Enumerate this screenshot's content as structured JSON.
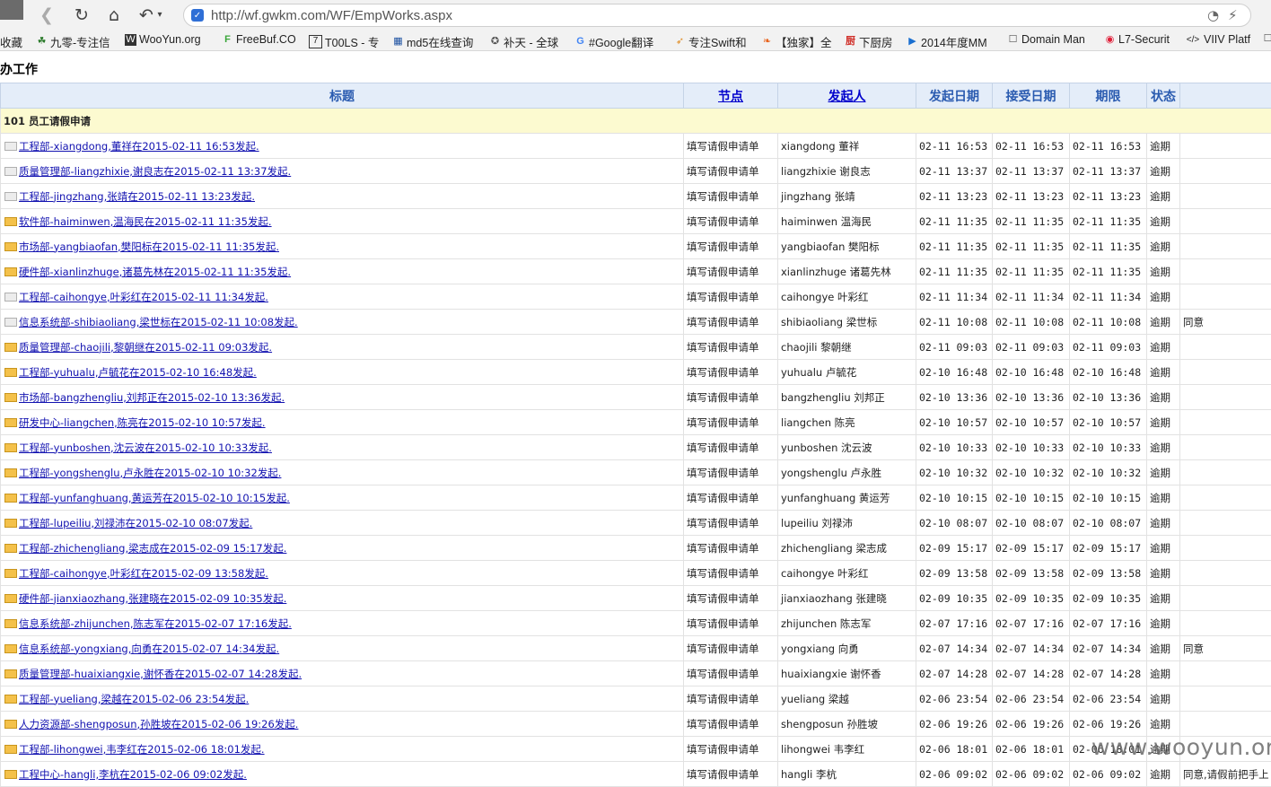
{
  "browser": {
    "url": "http://wf.gwkm.com/WF/EmpWorks.aspx",
    "bookmarks": [
      {
        "label": "收藏",
        "icon": "none-icon"
      },
      {
        "label": "九零-专注信",
        "icon": "leaf-icon"
      },
      {
        "label": "WooYun.org",
        "icon": "wooyun-icon"
      },
      {
        "label": "FreeBuf.CO",
        "icon": "freebuf-icon"
      },
      {
        "label": "T00LS - 专",
        "icon": "tools-icon"
      },
      {
        "label": "md5在线查询",
        "icon": "grid-icon"
      },
      {
        "label": "补天 - 全球",
        "icon": "star-icon"
      },
      {
        "label": "#Google翻译",
        "icon": "translate-icon"
      },
      {
        "label": "专注Swift和",
        "icon": "swift-icon"
      },
      {
        "label": "【独家】全",
        "icon": "fire-icon"
      },
      {
        "label": "下厨房",
        "icon": "kitchen-icon"
      },
      {
        "label": "2014年度MM",
        "icon": "play-icon"
      },
      {
        "label": "Domain Man",
        "icon": "page-icon"
      },
      {
        "label": "L7-Securit",
        "icon": "l7-icon"
      },
      {
        "label": "VIIV Platf",
        "icon": "code-icon"
      }
    ]
  },
  "page": {
    "title": "办工作",
    "columns": {
      "title": "标题",
      "node": "节点",
      "initiator": "发起人",
      "start_date": "发起日期",
      "accept_date": "接受日期",
      "deadline": "期限",
      "status": "状态"
    },
    "group": "101  员工请假申请",
    "rows": [
      {
        "icon": "doc",
        "title": "工程部-xiangdong,董祥在2015-02-11 16:53发起.",
        "node": "填写请假申请单",
        "initiator": "xiangdong 董祥",
        "start": "02-11 16:53",
        "accept": "02-11 16:53",
        "deadline": "02-11 16:53",
        "status": "逾期",
        "note": ""
      },
      {
        "icon": "doc",
        "title": "质量管理部-liangzhixie,谢良志在2015-02-11 13:37发起.",
        "node": "填写请假申请单",
        "initiator": "liangzhixie 谢良志",
        "start": "02-11 13:37",
        "accept": "02-11 13:37",
        "deadline": "02-11 13:37",
        "status": "逾期",
        "note": ""
      },
      {
        "icon": "doc",
        "title": "工程部-jingzhang,张靖在2015-02-11 13:23发起.",
        "node": "填写请假申请单",
        "initiator": "jingzhang 张靖",
        "start": "02-11 13:23",
        "accept": "02-11 13:23",
        "deadline": "02-11 13:23",
        "status": "逾期",
        "note": ""
      },
      {
        "icon": "folder",
        "title": "软件部-haiminwen,温海民在2015-02-11 11:35发起.",
        "node": "填写请假申请单",
        "initiator": "haiminwen 温海民",
        "start": "02-11 11:35",
        "accept": "02-11 11:35",
        "deadline": "02-11 11:35",
        "status": "逾期",
        "note": ""
      },
      {
        "icon": "folder",
        "title": "市场部-yangbiaofan,樊阳标在2015-02-11 11:35发起.",
        "node": "填写请假申请单",
        "initiator": "yangbiaofan 樊阳标",
        "start": "02-11 11:35",
        "accept": "02-11 11:35",
        "deadline": "02-11 11:35",
        "status": "逾期",
        "note": ""
      },
      {
        "icon": "folder",
        "title": "硬件部-xianlinzhuge,诸葛先林在2015-02-11 11:35发起.",
        "node": "填写请假申请单",
        "initiator": "xianlinzhuge 诸葛先林",
        "start": "02-11 11:35",
        "accept": "02-11 11:35",
        "deadline": "02-11 11:35",
        "status": "逾期",
        "note": ""
      },
      {
        "icon": "doc",
        "title": "工程部-caihongye,叶彩红在2015-02-11 11:34发起.",
        "node": "填写请假申请单",
        "initiator": "caihongye 叶彩红",
        "start": "02-11 11:34",
        "accept": "02-11 11:34",
        "deadline": "02-11 11:34",
        "status": "逾期",
        "note": ""
      },
      {
        "icon": "doc",
        "title": "信息系统部-shibiaoliang,梁世标在2015-02-11 10:08发起.",
        "node": "填写请假申请单",
        "initiator": "shibiaoliang 梁世标",
        "start": "02-11 10:08",
        "accept": "02-11 10:08",
        "deadline": "02-11 10:08",
        "status": "逾期",
        "note": "同意"
      },
      {
        "icon": "folder",
        "title": "质量管理部-chaojili,黎朝继在2015-02-11 09:03发起.",
        "node": "填写请假申请单",
        "initiator": "chaojili 黎朝继",
        "start": "02-11 09:03",
        "accept": "02-11 09:03",
        "deadline": "02-11 09:03",
        "status": "逾期",
        "note": ""
      },
      {
        "icon": "folder",
        "title": "工程部-yuhualu,卢毓花在2015-02-10 16:48发起.",
        "node": "填写请假申请单",
        "initiator": "yuhualu 卢毓花",
        "start": "02-10 16:48",
        "accept": "02-10 16:48",
        "deadline": "02-10 16:48",
        "status": "逾期",
        "note": ""
      },
      {
        "icon": "folder",
        "title": "市场部-bangzhengliu,刘邦正在2015-02-10 13:36发起.",
        "node": "填写请假申请单",
        "initiator": "bangzhengliu 刘邦正",
        "start": "02-10 13:36",
        "accept": "02-10 13:36",
        "deadline": "02-10 13:36",
        "status": "逾期",
        "note": ""
      },
      {
        "icon": "folder",
        "title": "研发中心-liangchen,陈亮在2015-02-10 10:57发起.",
        "node": "填写请假申请单",
        "initiator": "liangchen 陈亮",
        "start": "02-10 10:57",
        "accept": "02-10 10:57",
        "deadline": "02-10 10:57",
        "status": "逾期",
        "note": ""
      },
      {
        "icon": "folder",
        "title": "工程部-yunboshen,沈云波在2015-02-10 10:33发起.",
        "node": "填写请假申请单",
        "initiator": "yunboshen 沈云波",
        "start": "02-10 10:33",
        "accept": "02-10 10:33",
        "deadline": "02-10 10:33",
        "status": "逾期",
        "note": ""
      },
      {
        "icon": "folder",
        "title": "工程部-yongshenglu,卢永胜在2015-02-10 10:32发起.",
        "node": "填写请假申请单",
        "initiator": "yongshenglu 卢永胜",
        "start": "02-10 10:32",
        "accept": "02-10 10:32",
        "deadline": "02-10 10:32",
        "status": "逾期",
        "note": ""
      },
      {
        "icon": "folder",
        "title": "工程部-yunfanghuang,黄运芳在2015-02-10 10:15发起.",
        "node": "填写请假申请单",
        "initiator": "yunfanghuang 黄运芳",
        "start": "02-10 10:15",
        "accept": "02-10 10:15",
        "deadline": "02-10 10:15",
        "status": "逾期",
        "note": ""
      },
      {
        "icon": "folder",
        "title": "工程部-lupeiliu,刘禄沛在2015-02-10 08:07发起.",
        "node": "填写请假申请单",
        "initiator": "lupeiliu 刘禄沛",
        "start": "02-10 08:07",
        "accept": "02-10 08:07",
        "deadline": "02-10 08:07",
        "status": "逾期",
        "note": ""
      },
      {
        "icon": "folder",
        "title": "工程部-zhichengliang,梁志成在2015-02-09 15:17发起.",
        "node": "填写请假申请单",
        "initiator": "zhichengliang 梁志成",
        "start": "02-09 15:17",
        "accept": "02-09 15:17",
        "deadline": "02-09 15:17",
        "status": "逾期",
        "note": ""
      },
      {
        "icon": "folder",
        "title": "工程部-caihongye,叶彩红在2015-02-09 13:58发起.",
        "node": "填写请假申请单",
        "initiator": "caihongye 叶彩红",
        "start": "02-09 13:58",
        "accept": "02-09 13:58",
        "deadline": "02-09 13:58",
        "status": "逾期",
        "note": ""
      },
      {
        "icon": "folder",
        "title": "硬件部-jianxiaozhang,张建晓在2015-02-09 10:35发起.",
        "node": "填写请假申请单",
        "initiator": "jianxiaozhang 张建晓",
        "start": "02-09 10:35",
        "accept": "02-09 10:35",
        "deadline": "02-09 10:35",
        "status": "逾期",
        "note": ""
      },
      {
        "icon": "folder",
        "title": "信息系统部-zhijunchen,陈志军在2015-02-07 17:16发起.",
        "node": "填写请假申请单",
        "initiator": "zhijunchen 陈志军",
        "start": "02-07 17:16",
        "accept": "02-07 17:16",
        "deadline": "02-07 17:16",
        "status": "逾期",
        "note": ""
      },
      {
        "icon": "folder",
        "title": "信息系统部-yongxiang,向勇在2015-02-07 14:34发起.",
        "node": "填写请假申请单",
        "initiator": "yongxiang 向勇",
        "start": "02-07 14:34",
        "accept": "02-07 14:34",
        "deadline": "02-07 14:34",
        "status": "逾期",
        "note": "同意"
      },
      {
        "icon": "folder",
        "title": "质量管理部-huaixiangxie,谢怀香在2015-02-07 14:28发起.",
        "node": "填写请假申请单",
        "initiator": "huaixiangxie 谢怀香",
        "start": "02-07 14:28",
        "accept": "02-07 14:28",
        "deadline": "02-07 14:28",
        "status": "逾期",
        "note": ""
      },
      {
        "icon": "folder",
        "title": "工程部-yueliang,梁越在2015-02-06 23:54发起.",
        "node": "填写请假申请单",
        "initiator": "yueliang 梁越",
        "start": "02-06 23:54",
        "accept": "02-06 23:54",
        "deadline": "02-06 23:54",
        "status": "逾期",
        "note": ""
      },
      {
        "icon": "folder",
        "title": "人力资源部-shengposun,孙胜坡在2015-02-06 19:26发起.",
        "node": "填写请假申请单",
        "initiator": "shengposun 孙胜坡",
        "start": "02-06 19:26",
        "accept": "02-06 19:26",
        "deadline": "02-06 19:26",
        "status": "逾期",
        "note": ""
      },
      {
        "icon": "folder",
        "title": "工程部-lihongwei,韦李红在2015-02-06 18:01发起.",
        "node": "填写请假申请单",
        "initiator": "lihongwei 韦李红",
        "start": "02-06 18:01",
        "accept": "02-06 18:01",
        "deadline": "02-06 18:01",
        "status": "逾期",
        "note": ""
      },
      {
        "icon": "folder",
        "title": "工程中心-hangli,李杭在2015-02-06 09:02发起.",
        "node": "填写请假申请单",
        "initiator": "hangli 李杭",
        "start": "02-06 09:02",
        "accept": "02-06 09:02",
        "deadline": "02-06 09:02",
        "status": "逾期",
        "note": "同意,请假前把手上"
      }
    ]
  },
  "watermark": "www.wooyun.org",
  "colors": {
    "header_bg": "#e4edf9",
    "header_text": "#2a5bb0",
    "group_bg": "#fcfad0",
    "link": "#1212b0",
    "overdue": "#e02020"
  }
}
